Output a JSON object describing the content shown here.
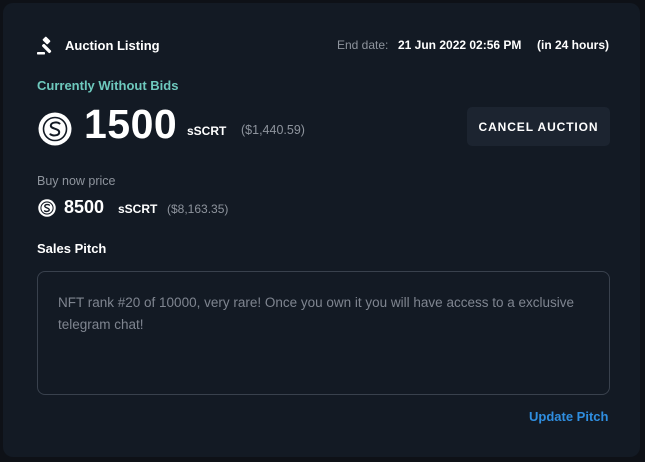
{
  "header": {
    "title": "Auction Listing",
    "end_label": "End date:",
    "end_value": "21 Jun 2022 02:56 PM",
    "end_relative": "(in 24 hours)"
  },
  "auction": {
    "status": "Currently Without Bids",
    "price": "1500",
    "unit": "sSCRT",
    "usd": "($1,440.59)",
    "cancel_label": "CANCEL AUCTION"
  },
  "buy_now": {
    "label": "Buy now price",
    "price": "8500",
    "unit": "sSCRT",
    "usd": "($8,163.35)"
  },
  "pitch": {
    "label": "Sales Pitch",
    "text": "NFT rank #20 of 10000, very rare! Once you own it you will have access to a exclusive telegram chat!",
    "update_label": "Update Pitch"
  },
  "icons": {
    "gavel": "gavel-icon",
    "coin": "scrt-coin-icon"
  },
  "colors": {
    "background": "#0e1117",
    "card": "#131a24",
    "status_accent": "#6ec9bd",
    "link": "#2f8ee0",
    "button_bg": "#1c2430"
  }
}
